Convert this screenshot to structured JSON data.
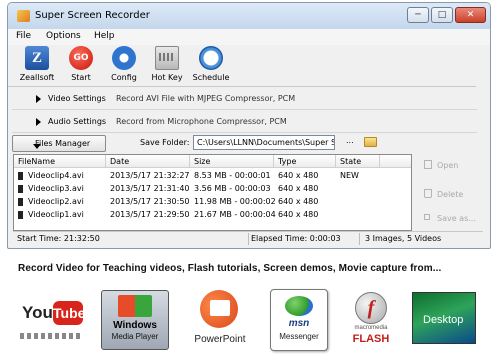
{
  "window": {
    "title": "Super Screen Recorder",
    "minimize_icon": "─",
    "maximize_icon": "□",
    "close_icon": "✕"
  },
  "menu": [
    "File",
    "Options",
    "Help"
  ],
  "toolbar": [
    {
      "label": "Zeallsoft",
      "icon": "zeallsoft-logo-icon",
      "glyph": "Z"
    },
    {
      "label": "Start",
      "icon": "go-start-icon",
      "glyph": "GO"
    },
    {
      "label": "Config",
      "icon": "gear-icon",
      "glyph": ""
    },
    {
      "label": "Hot Key",
      "icon": "keyboard-icon",
      "glyph": ""
    },
    {
      "label": "Schedule",
      "icon": "clock-icon",
      "glyph": ""
    }
  ],
  "sections": {
    "video": {
      "label": "Video Settings",
      "description": "Record AVI File with MJPEG Compressor, PCM"
    },
    "audio": {
      "label": "Audio Settings",
      "description": "Record from Microphone  Compressor, PCM"
    }
  },
  "file_manager": {
    "button_label": "Files Manager",
    "save_folder_label": "Save Folder:",
    "save_folder_value": "C:\\Users\\LLNN\\Documents\\Super Sc",
    "browse_label": "..."
  },
  "table": {
    "columns": [
      "FileName",
      "Date",
      "Size",
      "Type",
      "State"
    ],
    "rows": [
      {
        "filename": "Videoclip4.avi",
        "date": "2013/5/17 21:32:27",
        "size": "8.53 MB - 00:00:01",
        "type": "640 x 480",
        "state": "NEW"
      },
      {
        "filename": "Videoclip3.avi",
        "date": "2013/5/17 21:31:40",
        "size": "3.56 MB - 00:00:03",
        "type": "640 x 480",
        "state": ""
      },
      {
        "filename": "Videoclip2.avi",
        "date": "2013/5/17 21:30:50",
        "size": "11.98 MB - 00:00:02",
        "type": "640 x 480",
        "state": ""
      },
      {
        "filename": "Videoclip1.avi",
        "date": "2013/5/17 21:29:50",
        "size": "21.67 MB - 00:00:04",
        "type": "640 x 480",
        "state": ""
      }
    ]
  },
  "side_actions": {
    "open": "Open",
    "delete": "Delete",
    "save_as": "Save as..."
  },
  "status": {
    "start_time": "Start Time: 21:32:50",
    "elapsed_time": "Elapsed Time: 0:00:03",
    "counts": "3 Images, 5 Videos"
  },
  "promo": {
    "headline": "Record Video for Teaching videos, Flash tutorials, Screen demos, Movie capture from..."
  },
  "logos": {
    "youtube": {
      "text_you": "You",
      "text_tube": "Tube"
    },
    "windows_media_player": {
      "line1": "Windows",
      "line2": "Media Player"
    },
    "powerpoint": {
      "label": "PowerPoint"
    },
    "msn": {
      "brand": "msn",
      "label": "Messenger"
    },
    "flash": {
      "brand_small": "macromedia",
      "label": "FLASH",
      "glyph": "f"
    },
    "desktop": {
      "label": "Desktop"
    }
  }
}
